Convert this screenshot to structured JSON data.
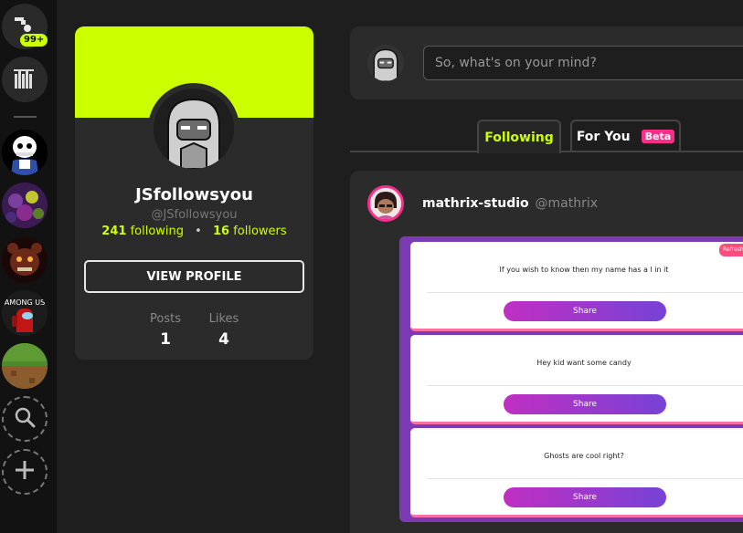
{
  "sidebar": {
    "notifications_badge": "99+",
    "icons": [
      "chat-logo-icon",
      "library-icon",
      "search-icon",
      "plus-icon"
    ],
    "servers": [
      "sans-skeleton",
      "purple-characters",
      "dark-red-animatronic",
      "among-us",
      "minecraft-grass-block"
    ],
    "server_texts": [
      "AMONG US"
    ]
  },
  "profile": {
    "name": "JSfollowsyou",
    "handle": "@JSfollowsyou",
    "following_count": "241",
    "following_label": "following",
    "separator": "•",
    "followers_count": "16",
    "followers_label": "followers",
    "view_profile_label": "VIEW PROFILE",
    "posts_label": "Posts",
    "posts_value": "1",
    "likes_label": "Likes",
    "likes_value": "4",
    "banner_color": "#ccff00"
  },
  "compose": {
    "placeholder": "So, what's on your mind?"
  },
  "tabs": {
    "following": "Following",
    "for_you": "For You",
    "beta": "Beta",
    "active": "Following"
  },
  "post": {
    "author": "mathrix-studio",
    "handle": "@mathrix",
    "embed": {
      "refresh_label": "Refresh",
      "cards": [
        {
          "text": "If you wish to know then my name has a l in it",
          "button": "Share"
        },
        {
          "text": "Hey kid want some candy",
          "button": "Share"
        },
        {
          "text": "Ghosts are cool right?",
          "button": "Share"
        }
      ]
    }
  },
  "colors": {
    "accent": "#ccff00",
    "pink": "#ff2d8a",
    "background": "#1e1e1e",
    "panel": "#2b2b2b",
    "rail": "#121212"
  }
}
